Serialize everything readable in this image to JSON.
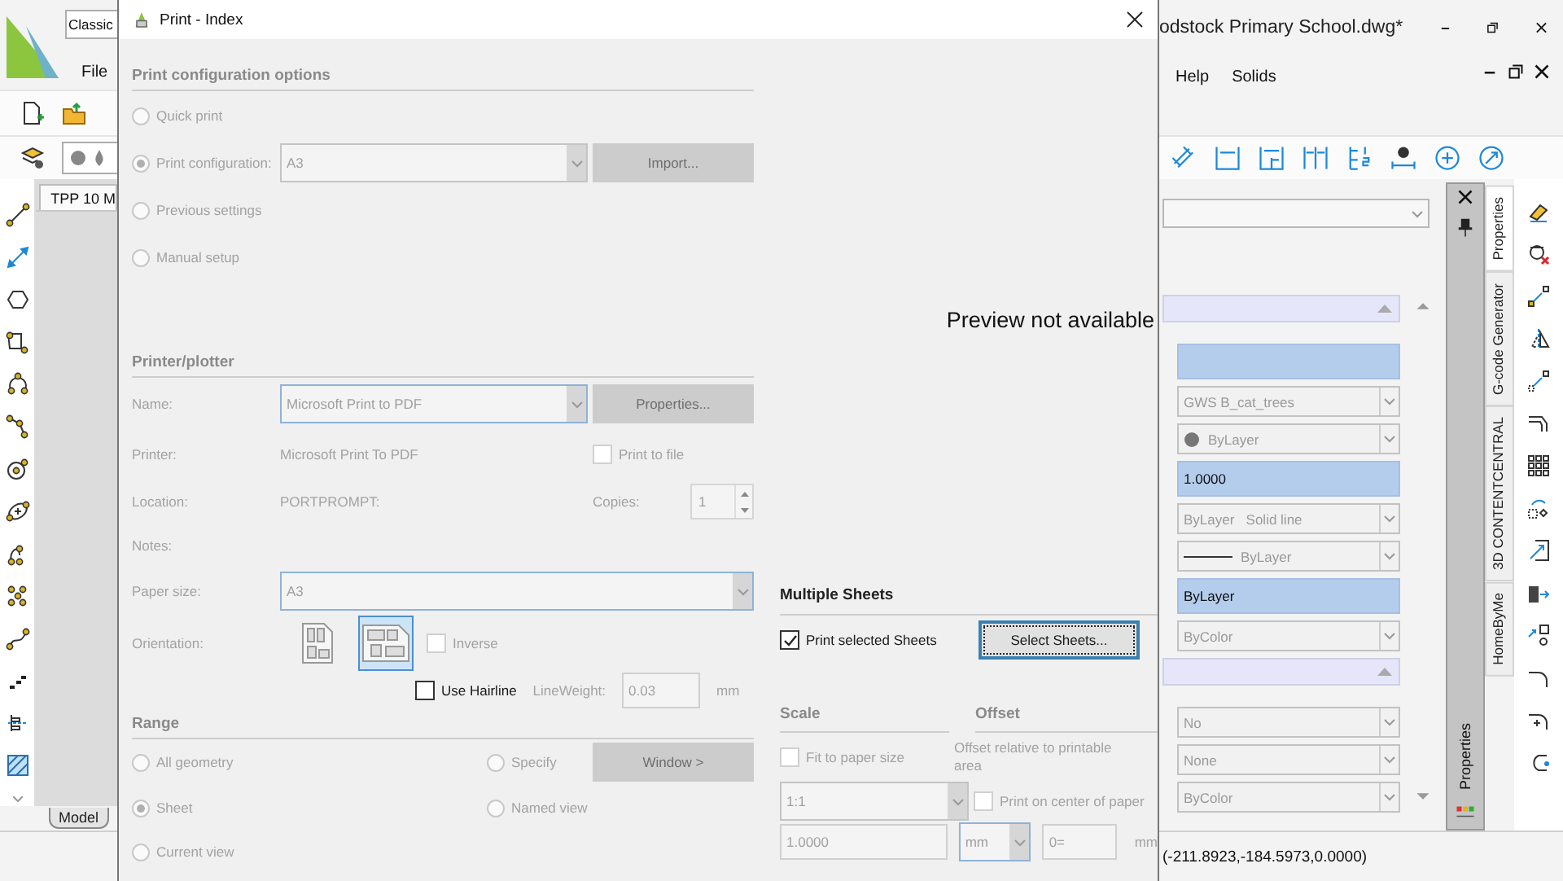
{
  "app": {
    "workspace": "Classic",
    "title": "odstock Primary School.dwg*",
    "menu_left": [
      "File"
    ],
    "menu_right": [
      "Help",
      "Solids"
    ],
    "drawing_tab": "TPP 10 M",
    "layout_tab": "Model",
    "coordinates": "(-211.8923,-184.5973,0.0000)"
  },
  "properties_panel": {
    "rows": [
      {
        "kind": "section"
      },
      {
        "kind": "highlight"
      },
      {
        "kind": "combo",
        "value": "GWS B_cat_trees"
      },
      {
        "kind": "color_combo",
        "value": "ByLayer"
      },
      {
        "kind": "highlight",
        "value": "1.0000"
      },
      {
        "kind": "linetype_combo",
        "value": "ByLayer",
        "detail": "Solid line"
      },
      {
        "kind": "lineweight_combo",
        "value": "ByLayer"
      },
      {
        "kind": "highlight",
        "value": "ByLayer"
      },
      {
        "kind": "combo",
        "value": "ByColor"
      },
      {
        "kind": "section"
      },
      {
        "kind": "combo",
        "value": "No"
      },
      {
        "kind": "combo",
        "value": "None"
      },
      {
        "kind": "combo",
        "value": "ByColor"
      }
    ]
  },
  "dock_title": "Properties",
  "side_tabs": [
    {
      "label": "Properties",
      "selected": true
    },
    {
      "label": "G-code Generator",
      "selected": false
    },
    {
      "label": "3D CONTENTCENTRAL",
      "selected": false
    },
    {
      "label": "HomeByMe",
      "selected": false
    }
  ],
  "dialog": {
    "title": "Print - Index",
    "config_section": {
      "heading": "Print configuration options",
      "disabled": true,
      "options": [
        {
          "label": "Quick print",
          "selected": false,
          "disabled": true
        },
        {
          "label": "Print configuration:",
          "selected": true,
          "disabled": true,
          "combo": "A3",
          "button": {
            "label": "Import...",
            "disabled": true
          }
        },
        {
          "label": "Previous settings",
          "selected": false,
          "disabled": true
        },
        {
          "label": "Manual setup",
          "selected": false,
          "disabled": true
        }
      ]
    },
    "printer_section": {
      "heading": "Printer/plotter",
      "disabled": true,
      "name_label": "Name:",
      "name_value": "Microsoft Print to PDF",
      "properties_button": {
        "label": "Properties...",
        "disabled": true
      },
      "printer_label": "Printer:",
      "printer_value": "Microsoft Print To PDF",
      "print_to_file": {
        "label": "Print to file",
        "checked": false,
        "disabled": true
      },
      "location_label": "Location:",
      "location_value": "PORTPROMPT:",
      "copies_label": "Copies:",
      "copies_value": "1",
      "notes_label": "Notes:",
      "paper_label": "Paper size:",
      "paper_value": "A3",
      "orientation_label": "Orientation:",
      "orientations": [
        {
          "kind": "portrait",
          "selected": false
        },
        {
          "kind": "landscape",
          "selected": true
        }
      ],
      "inverse": {
        "label": "Inverse",
        "checked": false,
        "disabled": true
      },
      "hairline": {
        "label": "Use Hairline",
        "checked": false,
        "disabled": false
      },
      "lineweight_label": "LineWeight:",
      "lineweight_value": "0.03",
      "lineweight_unit": "mm"
    },
    "range_section": {
      "heading": "Range",
      "disabled": true,
      "options": [
        {
          "label": "All geometry",
          "selected": false,
          "disabled": true
        },
        {
          "label": "Specify",
          "selected": false,
          "disabled": true
        },
        {
          "label": "Sheet",
          "selected": true,
          "disabled": true
        },
        {
          "label": "Named view",
          "selected": false,
          "disabled": true
        },
        {
          "label": "Current view",
          "selected": false,
          "disabled": true
        }
      ],
      "window_button": {
        "label": "Window >",
        "disabled": true
      }
    },
    "preview_text": "Preview not available",
    "sheets_section": {
      "heading": "Multiple Sheets",
      "disabled": false,
      "print_selected": {
        "label": "Print selected Sheets",
        "checked": true,
        "disabled": false
      },
      "select_button": {
        "label": "Select Sheets...",
        "disabled": false
      }
    },
    "scale_section": {
      "heading": "Scale",
      "disabled": true,
      "fit": {
        "label": "Fit to paper size",
        "checked": false,
        "disabled": true
      },
      "scale_value": "1:1",
      "factor_value": "1.0000",
      "unit_value": "mm"
    },
    "offset_section": {
      "heading": "Offset",
      "disabled": true,
      "note": "Offset relative to printable area",
      "center": {
        "label": "Print on center of paper",
        "checked": false,
        "disabled": true
      },
      "x_value": "0=",
      "x_unit": "mm"
    }
  }
}
